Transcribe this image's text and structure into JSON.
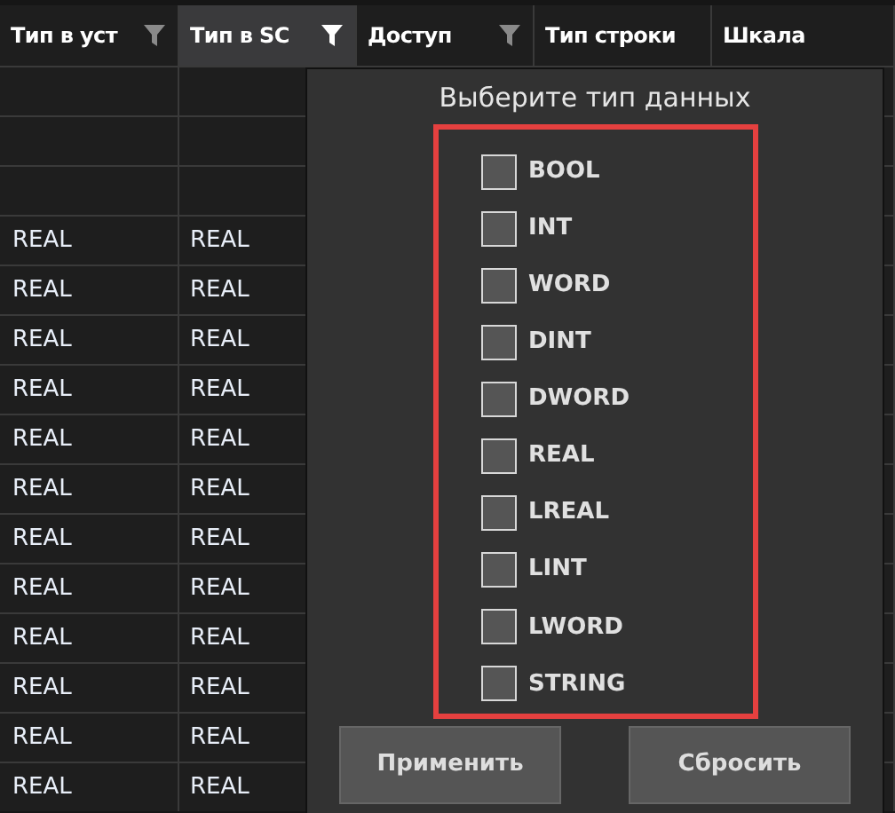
{
  "table": {
    "columns": [
      {
        "label": "Тип в уст",
        "has_filter": true,
        "filter_active": false,
        "selected": false
      },
      {
        "label": "Тип в SC",
        "has_filter": true,
        "filter_active": true,
        "selected": true
      },
      {
        "label": "Доступ",
        "has_filter": true,
        "filter_active": false,
        "selected": false
      },
      {
        "label": "Тип строки",
        "has_filter": false,
        "selected": false
      },
      {
        "label": "Шкала",
        "has_filter": false,
        "selected": false
      }
    ],
    "rows": [
      {
        "column_1": "REAL",
        "column_2": "REAL"
      },
      {
        "column_1": "REAL",
        "column_2": "REAL"
      },
      {
        "column_1": "REAL",
        "column_2": "REAL"
      },
      {
        "column_1": "REAL",
        "column_2": "REAL"
      },
      {
        "column_1": "REAL",
        "column_2": "REAL"
      },
      {
        "column_1": "REAL",
        "column_2": "REAL"
      },
      {
        "column_1": "REAL",
        "column_2": "REAL"
      },
      {
        "column_1": "REAL",
        "column_2": "REAL"
      },
      {
        "column_1": "REAL",
        "column_2": "REAL"
      },
      {
        "column_1": "REAL",
        "column_2": "REAL"
      },
      {
        "column_1": "REAL",
        "column_2": "REAL"
      },
      {
        "column_1": "REAL",
        "column_2": "REAL"
      }
    ]
  },
  "filter_popup": {
    "title": "Выберите тип данных",
    "options": [
      {
        "label": "BOOL",
        "checked": false
      },
      {
        "label": "INT",
        "checked": false
      },
      {
        "label": "WORD",
        "checked": false
      },
      {
        "label": "DINT",
        "checked": false
      },
      {
        "label": "DWORD",
        "checked": false
      },
      {
        "label": "REAL",
        "checked": false
      },
      {
        "label": "LREAL",
        "checked": false
      },
      {
        "label": "LINT",
        "checked": false
      },
      {
        "label": "LWORD",
        "checked": false
      },
      {
        "label": "STRING",
        "checked": false
      }
    ],
    "buttons": [
      "Применить",
      "Сбросить"
    ]
  }
}
